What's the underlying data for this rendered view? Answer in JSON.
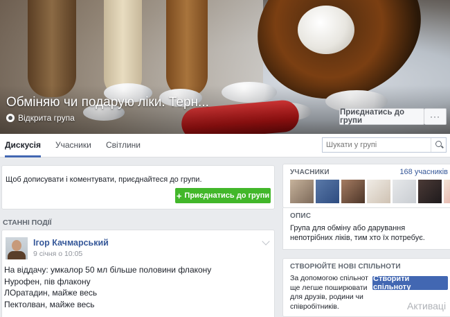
{
  "cover": {
    "title": "Обміняю чи подарую ліки. Терн...",
    "group_type": "Відкрита група",
    "join_label": "Приєднатись до групи",
    "more_label": "···"
  },
  "tabs": [
    {
      "label": "Дискусія",
      "active": true
    },
    {
      "label": "Учасники",
      "active": false
    },
    {
      "label": "Світлини",
      "active": false
    }
  ],
  "search": {
    "placeholder": "Шукати у групі"
  },
  "join_prompt": {
    "text": "Щоб дописувати і коментувати, приєднайтеся до групи.",
    "button_label": "Приєднатись до групи"
  },
  "recent_label": "СТАННІ ПОДІЇ",
  "post": {
    "author": "Ігор Качмарський",
    "date": "9 січня о 10:05",
    "lines": [
      "На віддачу: умкалор 50 мл більше половини флакону",
      "Нурофен, пів флакону",
      "ЛОратадин, майже весь",
      "Пектолван, майже весь"
    ]
  },
  "members": {
    "heading": "УЧАСНИКИ",
    "count": "168 учасників"
  },
  "about": {
    "heading": "ОПИС",
    "text": "Група для обміну або дарування непотрібних ліків, тим хто їх потребує."
  },
  "create": {
    "heading": "СТВОРЮЙТЕ НОВІ СПІЛЬНОТИ",
    "text": "За допомогою спільнот ще легше поширювати для друзів, родини чи співробітників.",
    "button_label": "Створити спільноту"
  },
  "watermark": "Активаці",
  "colors": {
    "brand_blue": "#4267b2",
    "join_green": "#42b72a",
    "link_blue": "#365899"
  }
}
